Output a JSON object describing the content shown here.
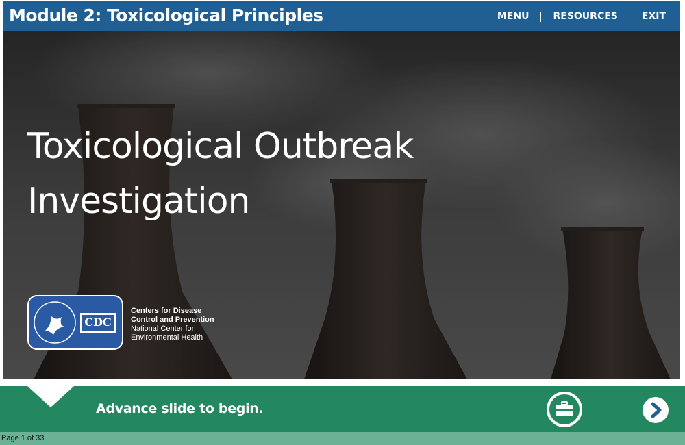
{
  "header": {
    "title": "Module 2: Toxicological Principles",
    "nav": [
      {
        "label": "MENU"
      },
      {
        "label": "RESOURCES"
      },
      {
        "label": "EXIT"
      }
    ]
  },
  "hero": {
    "title": "Toxicological Outbreak\nInvestigation",
    "logo_text": "CDC",
    "org_lines": [
      "Centers for Disease",
      "Control and Prevention",
      "National Center for",
      "Environmental Health"
    ]
  },
  "footer": {
    "instruction": "Advance slide to begin.",
    "toolbox_icon": "toolbox-icon",
    "next_icon": "chevron-right-icon"
  },
  "status": {
    "page_indicator": "Page 1 of 33"
  },
  "colors": {
    "header": "#1f5f93",
    "footer": "#23875f",
    "pagebar": "#6ab195",
    "next_chevron": "#1f5f93"
  }
}
